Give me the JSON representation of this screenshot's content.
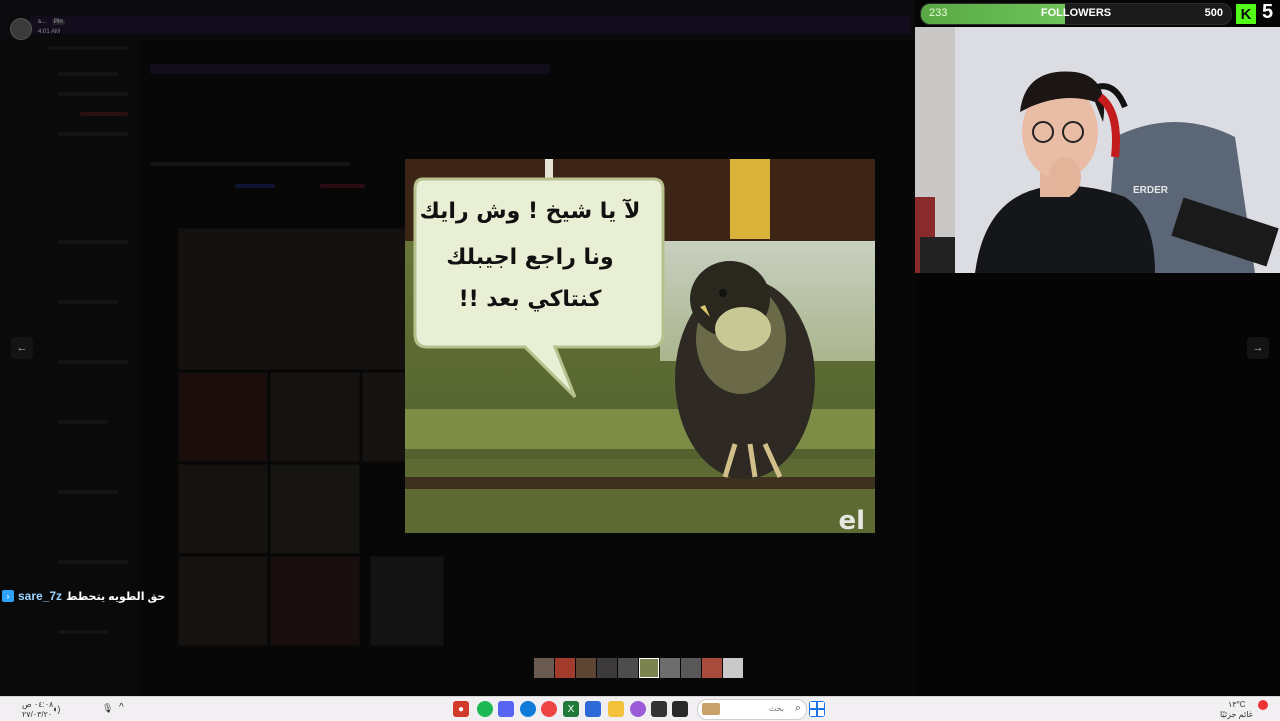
{
  "background_app": {
    "user_name": "s...",
    "user_tag": "Pin",
    "post_time": "4:01 AM"
  },
  "viewer": {
    "prev_icon": "arrow-left-icon",
    "next_icon": "arrow-right-icon",
    "prev_label": "←",
    "next_label": "→"
  },
  "meme": {
    "line1": "لآ يا شيخ ! وش رايك",
    "line2": "ونا راجع اجيبلك",
    "line3": "كنتاكي بعد !!",
    "corner_mark": "el"
  },
  "stream_overlay": {
    "followers_current": "233",
    "followers_label": "FOLLOWERS",
    "followers_goal": "500",
    "followers_progress": 0.466,
    "kick_logo": "K",
    "kick_count": "5",
    "chair_brand": "ERDER"
  },
  "chat": {
    "badge_icon": "kick-badge-icon",
    "username": "sare_7z",
    "separator": ":",
    "message": "حق الطويه يتحطط"
  },
  "taskbar": {
    "search_placeholder": "بحث",
    "time": "٠٤:٠٨ ص",
    "date": "٢٧/٠٣/٢٠",
    "weather": "١٣°C",
    "weather_desc": "غائم جزئيًا",
    "colors": {
      "bg": "#f1eff1",
      "windows_blue": "#1a73e8"
    }
  }
}
